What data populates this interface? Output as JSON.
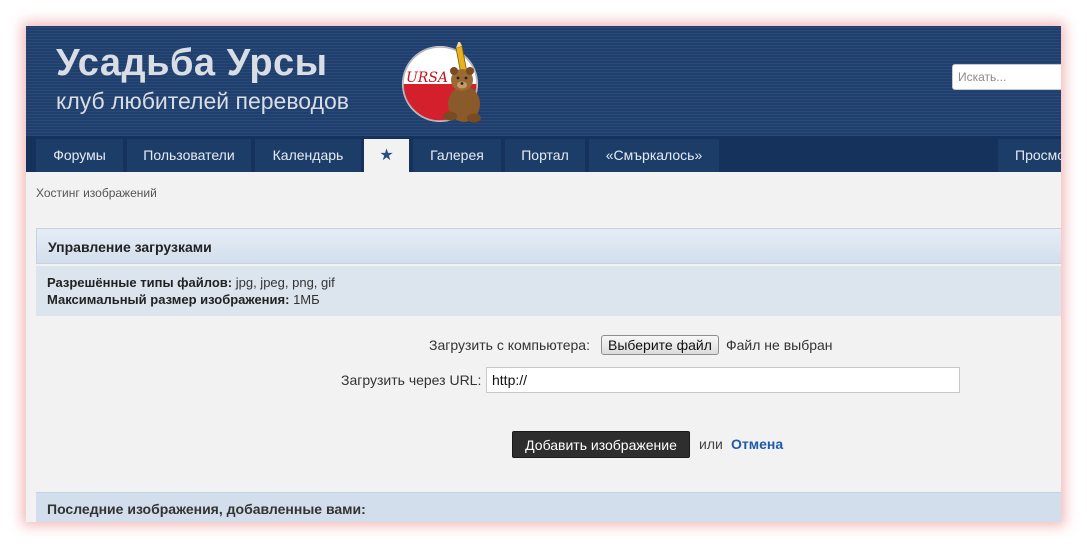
{
  "header": {
    "site_title": "Усадьба Урсы",
    "site_subtitle": "клуб любителей переводов",
    "logo_text": "URSA",
    "search_placeholder": "Искать..."
  },
  "nav": {
    "items": [
      {
        "label": "Форумы"
      },
      {
        "label": "Пользователи"
      },
      {
        "label": "Календарь"
      },
      {
        "label": "★",
        "active": true
      },
      {
        "label": "Галерея"
      },
      {
        "label": "Портал"
      },
      {
        "label": "«Смъркалось»"
      },
      {
        "label": "Просмо"
      }
    ]
  },
  "breadcrumb": "Хостинг изображений",
  "upload_section": {
    "title": "Управление загрузками",
    "allowed_types_label": "Разрешённые типы файлов:",
    "allowed_types_value": "jpg, jpeg, png, gif",
    "max_size_label": "Максимальный размер изображения:",
    "max_size_value": "1МБ",
    "from_computer_label": "Загрузить с компьютера:",
    "choose_file_button": "Выберите файл",
    "file_status": "Файл не выбран",
    "from_url_label": "Загрузить через URL:",
    "url_value": "http://",
    "submit_button": "Добавить изображение",
    "or_text": "или",
    "cancel_link": "Отмена"
  },
  "recent_section": {
    "title": "Последние изображения, добавленные вами:"
  },
  "colors": {
    "header_bg": "#1f3f6e",
    "nav_bg": "#15325c",
    "link": "#1f5aa6",
    "section_bg": "#d3deec"
  }
}
